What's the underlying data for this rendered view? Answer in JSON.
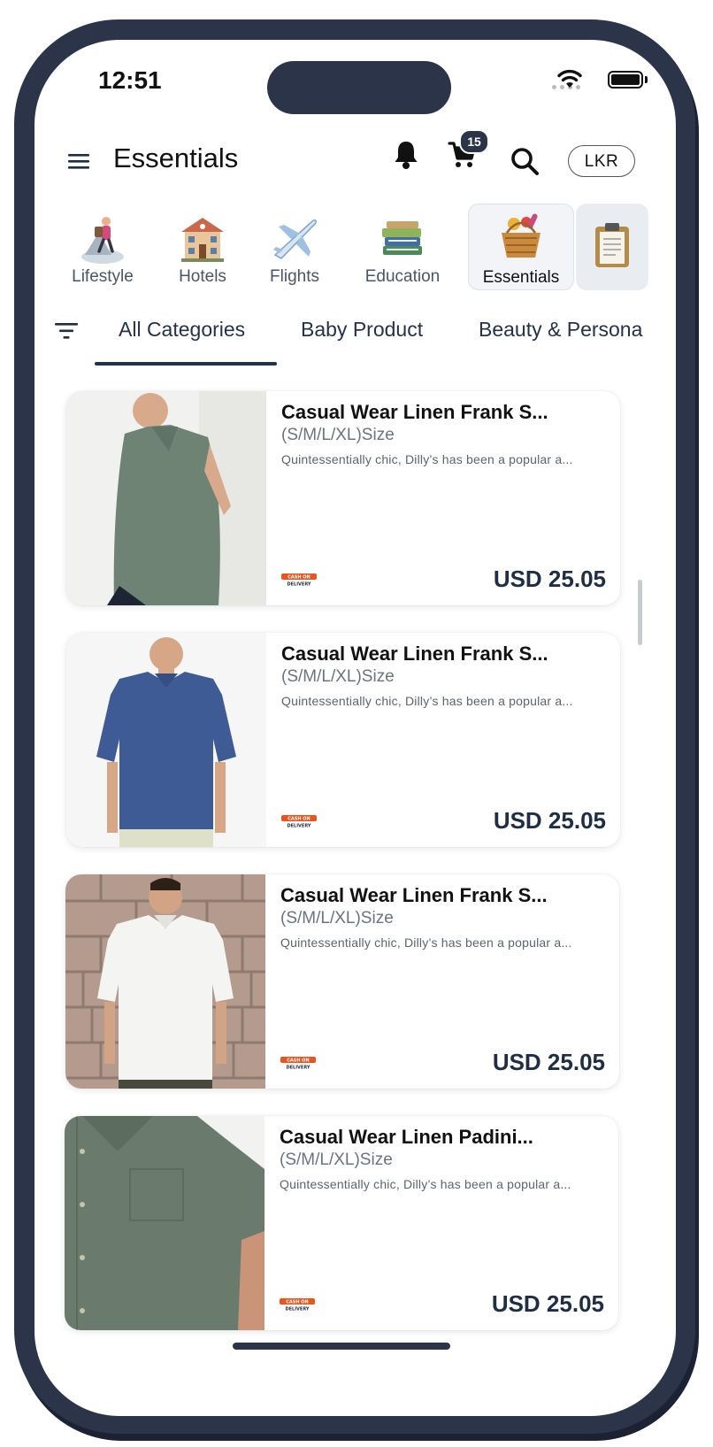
{
  "status_bar": {
    "time": "12:51"
  },
  "header": {
    "title": "Essentials",
    "cart_count": "15",
    "currency": "LKR"
  },
  "categories": [
    {
      "label": "Lifestyle",
      "icon": "hiker-icon"
    },
    {
      "label": "Hotels",
      "icon": "hotel-icon"
    },
    {
      "label": "Flights",
      "icon": "airplane-icon"
    },
    {
      "label": "Education",
      "icon": "books-icon"
    },
    {
      "label": "Essentials",
      "icon": "basket-icon",
      "active": true
    },
    {
      "label": "",
      "icon": "clipboard-icon"
    }
  ],
  "tabs": [
    {
      "label": "All Categories",
      "active": true
    },
    {
      "label": "Baby Product"
    },
    {
      "label": "Beauty & Persona"
    }
  ],
  "products": [
    {
      "title": "Casual Wear Linen Frank S...",
      "size": "(S/M/L/XL)Size",
      "description": "Quintessentially chic, Dilly’s has been a popular a...",
      "badge": "CASH ON DELIVERY",
      "price": "USD 25.05",
      "shirt_color": "#6f8375"
    },
    {
      "title": "Casual Wear Linen Frank S...",
      "size": "(S/M/L/XL)Size",
      "description": "Quintessentially chic, Dilly’s has been a popular a...",
      "badge": "CASH ON DELIVERY",
      "price": "USD 25.05",
      "shirt_color": "#3f5b95"
    },
    {
      "title": "Casual Wear Linen Frank S...",
      "size": "(S/M/L/XL)Size",
      "description": "Quintessentially chic, Dilly’s has been a popular a...",
      "badge": "CASH ON DELIVERY",
      "price": "USD 25.05",
      "shirt_color": "#f4f4f2"
    },
    {
      "title": "Casual Wear Linen Padini...",
      "size": "(S/M/L/XL)Size",
      "description": "Quintessentially chic, Dilly’s has been a popular a...",
      "badge": "CASH ON DELIVERY",
      "price": "USD 25.05",
      "shirt_color": "#6a7b6d"
    }
  ],
  "colors": {
    "frame": "#2b3448",
    "accent": "#1f3353",
    "price": "#1f2d45",
    "badge": "#e8561e"
  }
}
